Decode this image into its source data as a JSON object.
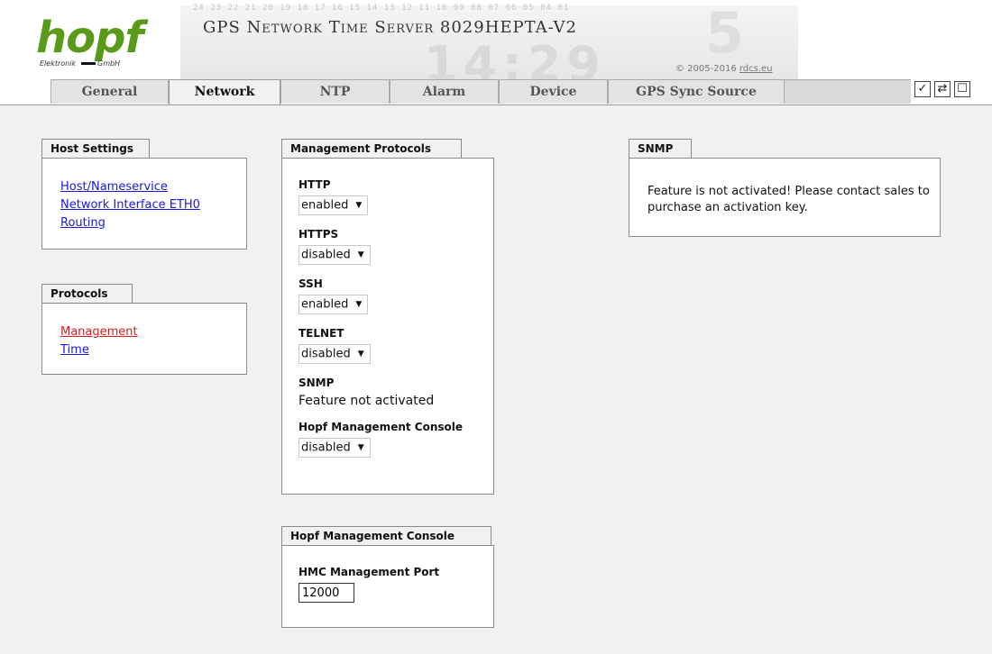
{
  "header": {
    "logo_text": "hopf",
    "logo_sub_left": "Elektronik",
    "logo_sub_right": "GmbH",
    "digits_row": "24 23 22 21 20 19 18 17 16 15 14 13 12 11 10 09 08 07 06 05 04 01",
    "background_time": "14:29",
    "background_digit": "5",
    "product_title": "GPS Network Time Server 8029HEPTA-V2",
    "copyright_prefix": "© 2005-2016 ",
    "copyright_link": "rdcs.eu"
  },
  "tabs": [
    {
      "label": "General",
      "active": false
    },
    {
      "label": "Network",
      "active": true
    },
    {
      "label": "NTP",
      "active": false
    },
    {
      "label": "Alarm",
      "active": false
    },
    {
      "label": "Device",
      "active": false
    },
    {
      "label": "GPS Sync Source",
      "active": false
    }
  ],
  "toolbar": {
    "apply_icon": "checkmark-icon",
    "apply_glyph": "✓",
    "reload_icon": "reload-icon",
    "reload_glyph": "⇄",
    "save_icon": "save-icon",
    "save_glyph": "☐"
  },
  "host_settings": {
    "title": "Host Settings",
    "links": [
      "Host/Nameservice",
      "Network Interface ETH0",
      "Routing"
    ]
  },
  "protocols": {
    "title": "Protocols",
    "links": [
      "Management",
      "Time"
    ],
    "active_link": "Management"
  },
  "management_protocols": {
    "title": "Management Protocols",
    "http": {
      "label": "HTTP",
      "value": "enabled"
    },
    "https": {
      "label": "HTTPS",
      "value": "disabled"
    },
    "ssh": {
      "label": "SSH",
      "value": "enabled"
    },
    "telnet": {
      "label": "TELNET",
      "value": "disabled"
    },
    "snmp": {
      "label": "SNMP",
      "text": "Feature not activated"
    },
    "hmc": {
      "label": "Hopf Management Console",
      "value": "disabled"
    }
  },
  "snmp_panel": {
    "title": "SNMP",
    "message": "Feature is not activated! Please contact sales to purchase an activation key."
  },
  "hmc_panel": {
    "title": "Hopf Management Console",
    "port_label": "HMC Management Port",
    "port_value": "12000"
  },
  "colors": {
    "logo_green": "#5a9a1a",
    "link_blue": "#1a1ad8",
    "link_active_red": "#d41e1e",
    "content_bg": "#f1f1f1"
  }
}
